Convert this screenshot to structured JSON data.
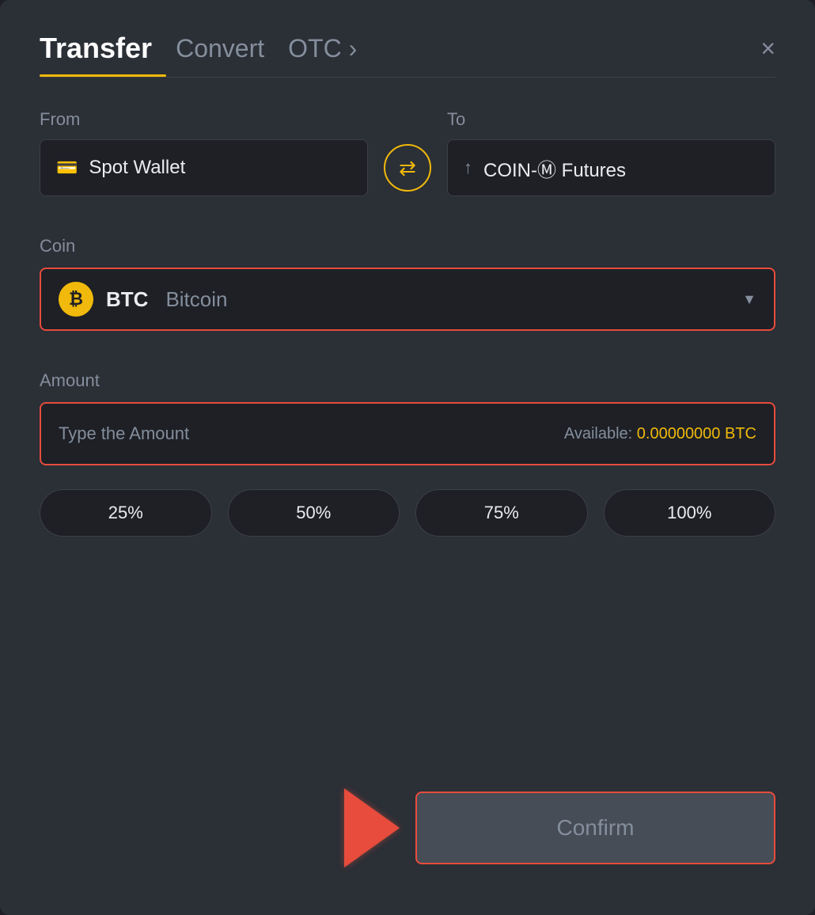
{
  "modal": {
    "title": "Transfer",
    "tabs": [
      {
        "id": "transfer",
        "label": "Transfer",
        "active": true
      },
      {
        "id": "convert",
        "label": "Convert",
        "active": false
      },
      {
        "id": "otc",
        "label": "OTC ›",
        "active": false
      }
    ],
    "close_icon": "×"
  },
  "from": {
    "label": "From",
    "wallet_icon": "🪪",
    "wallet_label": "Spot Wallet"
  },
  "to": {
    "label": "To",
    "wallet_icon": "↑",
    "wallet_label": "COIN-Ⓜ Futures"
  },
  "swap": {
    "icon": "⇄"
  },
  "coin": {
    "label": "Coin",
    "symbol": "BTC",
    "name": "Bitcoin",
    "btc_char": "₿"
  },
  "amount": {
    "label": "Amount",
    "placeholder": "Type the Amount",
    "available_label": "Available:",
    "available_value": "0.00000000 BTC"
  },
  "percentages": [
    "25%",
    "50%",
    "75%",
    "100%"
  ],
  "confirm": {
    "label": "Confirm"
  }
}
